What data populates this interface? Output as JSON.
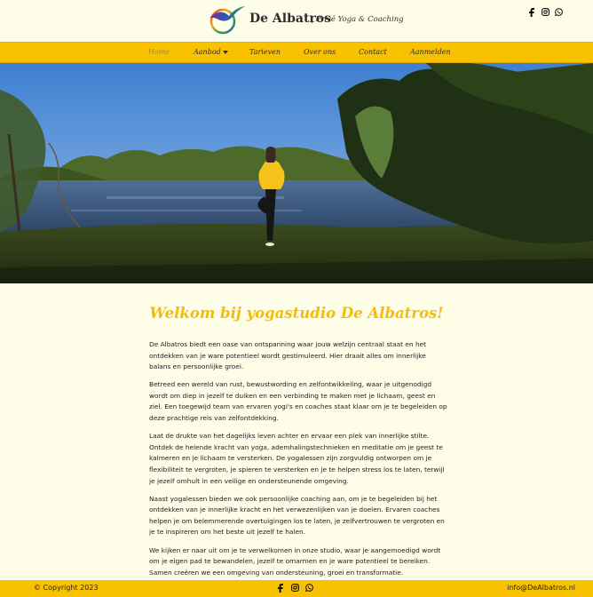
{
  "header": {
    "brand": "De Albatros",
    "tagline": "| Privé Yoga & Coaching",
    "social": [
      "facebook-icon",
      "instagram-icon",
      "whatsapp-icon"
    ]
  },
  "nav": {
    "items": [
      {
        "label": "Home",
        "active": true
      },
      {
        "label": "Aanbod",
        "dropdown": true
      },
      {
        "label": "Tarieven"
      },
      {
        "label": "Over ons"
      },
      {
        "label": "Contact"
      },
      {
        "label": "Aanmelden"
      }
    ]
  },
  "main": {
    "title": "Welkom bij yogastudio De Albatros!",
    "paragraphs": [
      "De Albatros biedt een oase van ontspanning waar jouw welzijn centraal staat en het ontdekken van je ware potentieel wordt gestimuleerd. Hier draait alles om innerlijke balans en persoonlijke groei.",
      "Betreed een wereld van rust, bewustwording en zelfontwikkeling, waar je uitgenodigd wordt om diep in jezelf te duiken en een verbinding te maken met je lichaam, geest en ziel. Een toegewijd team van ervaren yogi's en coaches staat klaar om je te begeleiden op deze prachtige reis van zelfontdekking.",
      "Laat de drukte van het dagelijks leven achter en ervaar een plek van innerlijke stilte. Ontdek de helende kracht van yoga, ademhalingstechnieken en meditatie om je geest te kalmeren en je lichaam te versterken. De yogalessen zijn zorgvuldig ontworpen om je flexibiliteit te vergroten, je spieren te versterken en je te helpen stress los te laten, terwijl je jezelf omhult in een veilige en ondersteunende omgeving.",
      "Naast yogalessen bieden we ook persoonlijke coaching aan, om je te begeleiden bij het ontdekken van je innerlijke kracht en het verwezenlijken van je doelen. Ervaren coaches helpen je om belemmerende overtuigingen los te laten, je zelfvertrouwen te vergroten en je te inspireren om het beste uit jezelf te halen.",
      "We kijken er naar uit om je te verwelkomen in onze studio, waar je aangemoedigd wordt om je eigen pad te bewandelen, jezelf te omarmen en je ware potentieel te bereiken. Samen creëren we een omgeving van ondersteuning, groei en transformatie."
    ]
  },
  "footer": {
    "copyright": "© Copyright 2023",
    "email": "info@DeAlbatros.nl"
  },
  "colors": {
    "accent": "#f8c200",
    "title": "#f2bd0c",
    "background": "#fefde8"
  }
}
